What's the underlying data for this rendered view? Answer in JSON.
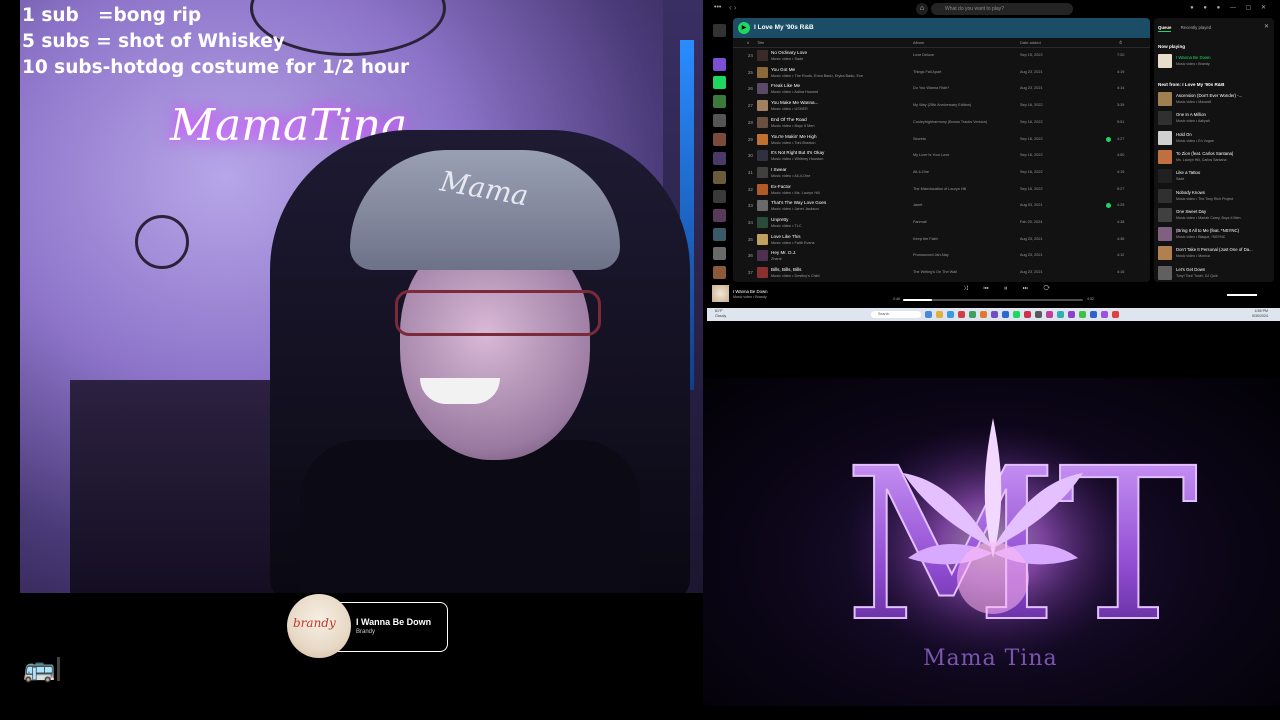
{
  "overlay": {
    "lines": [
      "1 sub   =bong rip",
      "5 subs = shot of Whiskey",
      "10 subs-hotdog costume for 1/2 hour"
    ]
  },
  "webcam": {
    "neon_sign": "MamaTina",
    "cap_text": "Mama"
  },
  "now_playing_card": {
    "title": "I Wanna Be Down",
    "artist": "Brandy",
    "art_text": "brandy"
  },
  "spotify": {
    "search_placeholder": "What do you want to play?",
    "playlist_title": "I Love My '90s R&B",
    "columns": {
      "num": "#",
      "title": "Title",
      "album": "Album",
      "date": "Date added",
      "dur": "⏱"
    },
    "rows": [
      {
        "num": "24",
        "title": "No Ordinary Love",
        "artist": "Music video • Sade",
        "album": "Love Deluxe",
        "date": "Sep 15, 2022",
        "dur": "7:20",
        "liked": false,
        "thumb": "#3a2a2a"
      },
      {
        "num": "25",
        "title": "You Got Me",
        "artist": "Music video • The Roots, Erica Badu, Eryka Badu, Eve",
        "album": "Things Fall Apart",
        "date": "Aug 23, 2021",
        "dur": "4:19",
        "liked": false,
        "thumb": "#8a6a3a"
      },
      {
        "num": "26",
        "title": "Freak Like Me",
        "artist": "Music video • Adina Howard",
        "album": "Do You Wanna Ride?",
        "date": "Aug 23, 2021",
        "dur": "4:14",
        "liked": false,
        "thumb": "#5a4a6a"
      },
      {
        "num": "27",
        "title": "You Make Me Wanna...",
        "artist": "Music video • USHER",
        "album": "My Way (25th Anniversary Edition)",
        "date": "Sep 16, 2022",
        "dur": "3:39",
        "liked": false,
        "thumb": "#a08060"
      },
      {
        "num": "28",
        "title": "End Of The Road",
        "artist": "Music video • Boyz II Men",
        "album": "Cooleyhighharmony (Bonus Tracks Version)",
        "date": "Sep 16, 2022",
        "dur": "5:51",
        "liked": false,
        "thumb": "#6a5040"
      },
      {
        "num": "29",
        "title": "You're Makin' Me High",
        "artist": "Music video • Toni Braxton",
        "album": "Secrets",
        "date": "Sep 16, 2022",
        "dur": "4:27",
        "liked": true,
        "thumb": "#c07030"
      },
      {
        "num": "30",
        "title": "It's Not Right But It's Okay",
        "artist": "Music video • Whitney Houston",
        "album": "My Love Is Your Love",
        "date": "Sep 16, 2022",
        "dur": "4:50",
        "liked": false,
        "thumb": "#303040"
      },
      {
        "num": "31",
        "title": "I Swear",
        "artist": "Music video • All-4-One",
        "album": "All-4-One",
        "date": "Sep 16, 2022",
        "dur": "4:19",
        "liked": false,
        "thumb": "#404040"
      },
      {
        "num": "32",
        "title": "Ex-Factor",
        "artist": "Music video • Ms. Lauryn Hill",
        "album": "The Miseducation of Lauryn Hill",
        "date": "Sep 16, 2022",
        "dur": "5:27",
        "liked": false,
        "thumb": "#b05a2a"
      },
      {
        "num": "33",
        "title": "That's The Way Love Goes",
        "artist": "Music video • Janet Jackson",
        "album": "Janet",
        "date": "Aug 03, 2021",
        "dur": "4:25",
        "liked": true,
        "thumb": "#6a6a6a"
      },
      {
        "num": "34",
        "title": "Unpretty",
        "artist": "Music video • TLC",
        "album": "Fanmail",
        "date": "Feb 20, 2024",
        "dur": "4:38",
        "liked": false,
        "thumb": "#2a4a3a"
      },
      {
        "num": "35",
        "title": "Love Like This",
        "artist": "Music video • Faith Evans",
        "album": "Keep the Faith",
        "date": "Aug 23, 2021",
        "dur": "4:36",
        "liked": false,
        "thumb": "#c0a060"
      },
      {
        "num": "36",
        "title": "Hey Mr. D.J.",
        "artist": "Zhané",
        "album": "Pronounced Jah-Nay",
        "date": "Aug 23, 2021",
        "dur": "4:12",
        "liked": false,
        "thumb": "#503050"
      },
      {
        "num": "37",
        "title": "Bills, Bills, Bills",
        "artist": "Music video • Destiny's Child",
        "album": "The Writing's On The Wall",
        "date": "Aug 23, 2021",
        "dur": "4:16",
        "liked": false,
        "thumb": "#8a3030"
      }
    ],
    "queue": {
      "tab_active": "Queue",
      "tab_other": "Recently played",
      "now_playing_label": "Now playing",
      "now_playing": {
        "title": "I Wanna Be Down",
        "artist": "Music video • Brandy"
      },
      "next_label": "Next from: I Love My '90s R&B",
      "items": [
        {
          "title": "Ascension (Don't Ever Wonder) -...",
          "artist": "Music video • Maxwell",
          "thumb": "#a08050"
        },
        {
          "title": "One In A Million",
          "artist": "Music video • Aaliyah",
          "thumb": "#303030"
        },
        {
          "title": "Hold On",
          "artist": "Music video • En Vogue",
          "thumb": "#d0d0d0"
        },
        {
          "title": "To Zion (feat. Carlos Santana)",
          "artist": "Ms. Lauryn Hill, Carlos Santana",
          "thumb": "#c07040"
        },
        {
          "title": "Like a Tattoo",
          "artist": "Sade",
          "thumb": "#202020"
        },
        {
          "title": "Nobody Knows",
          "artist": "Music video • The Tony Rich Project",
          "thumb": "#303030"
        },
        {
          "title": "One Sweet Day",
          "artist": "Music video • Mariah Carey, Boyz II Men",
          "thumb": "#404040"
        },
        {
          "title": "(Bring It All to Me (feat. *NSYNC)",
          "artist": "Music video • Blaque, *NSYNC",
          "thumb": "#806080"
        },
        {
          "title": "Don't Take It Personal (Just One of Da...",
          "artist": "Music video • Monica",
          "thumb": "#b08050"
        },
        {
          "title": "Let's Get Down",
          "artist": "Tony! Toni! Toné!, DJ Quik",
          "thumb": "#606060"
        }
      ]
    },
    "player": {
      "title": "I Wanna Be Down",
      "artist": "Music video • Brandy",
      "elapsed": "0:46",
      "total": "4:52",
      "progress": 0.16,
      "controls": "⤨ ⏮ ⏸ ⏭ ⟳"
    }
  },
  "taskbar": {
    "weather_temp": "61°F",
    "weather_desc": "Cloudy",
    "search_label": "Search",
    "time": "4:55 PM",
    "date": "5/30/2024"
  },
  "logo": {
    "brand_text": "Mama Tina",
    "monogram": "MT"
  },
  "bus_icon": "🚌"
}
